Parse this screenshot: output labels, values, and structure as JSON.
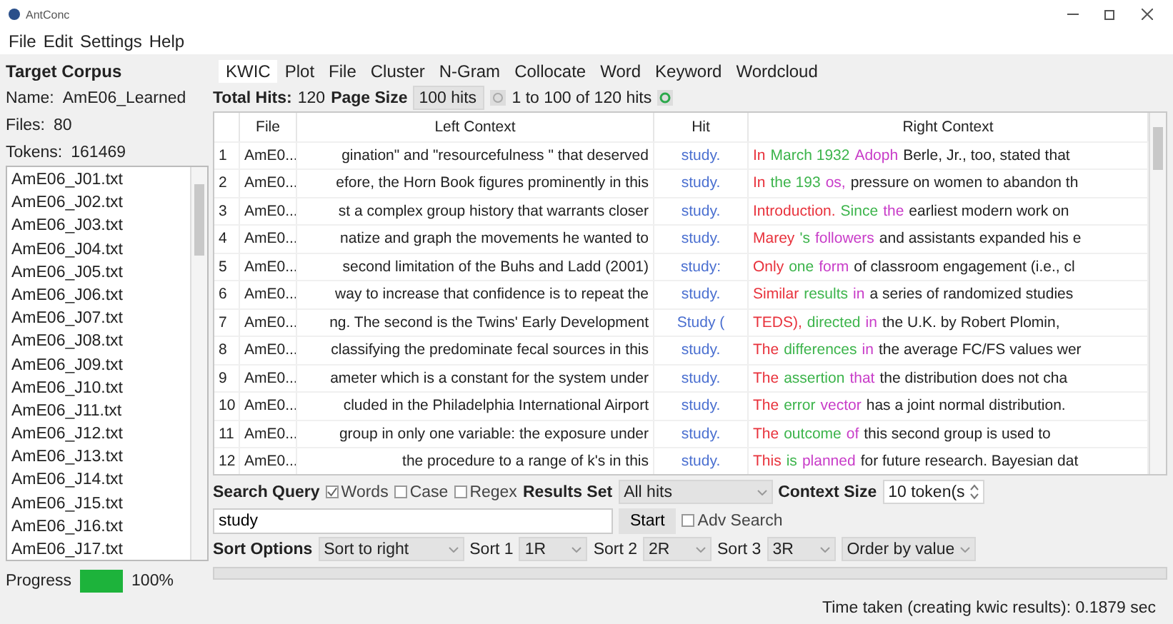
{
  "window": {
    "title": "AntConc"
  },
  "menu": [
    "File",
    "Edit",
    "Settings",
    "Help"
  ],
  "target_corpus": {
    "heading": "Target Corpus",
    "name_label": "Name:",
    "name": "AmE06_Learned",
    "files_label": "Files:",
    "files": "80",
    "tokens_label": "Tokens:",
    "tokens": "161469",
    "files_list": [
      "AmE06_J01.txt",
      "AmE06_J02.txt",
      "AmE06_J03.txt",
      "AmE06_J04.txt",
      "AmE06_J05.txt",
      "AmE06_J06.txt",
      "AmE06_J07.txt",
      "AmE06_J08.txt",
      "AmE06_J09.txt",
      "AmE06_J10.txt",
      "AmE06_J11.txt",
      "AmE06_J12.txt",
      "AmE06_J13.txt",
      "AmE06_J14.txt",
      "AmE06_J15.txt",
      "AmE06_J16.txt",
      "AmE06_J17.txt"
    ],
    "progress": {
      "label": "Progress",
      "level": 1,
      "reading": "100%"
    }
  },
  "tabs": [
    {
      "label": "KWIC",
      "selected": true
    },
    {
      "label": "Plot",
      "selected": false
    },
    {
      "label": "File",
      "selected": false
    },
    {
      "label": "Cluster",
      "selected": false
    },
    {
      "label": "N-Gram",
      "selected": false
    },
    {
      "label": "Collocate",
      "selected": false
    },
    {
      "label": "Word",
      "selected": false
    },
    {
      "label": "Keyword",
      "selected": false
    },
    {
      "label": "Wordcloud",
      "selected": false
    }
  ],
  "results_bar": {
    "total_hits_label": "Total Hits:",
    "total_hits": "120",
    "page_size_label": "Page Size",
    "page_size": "100 hits",
    "range": "1 to 100 of 120 hits"
  },
  "table": {
    "columns": [
      "File",
      "Left Context",
      "Hit",
      "Right Context"
    ],
    "rows": [
      {
        "number": "1",
        "file": "AmE0...",
        "left": "gination\" and \"resourcefulness \" that deserved",
        "hit": "study.",
        "right": [
          {
            "text": "In",
            "color": "#e8323c"
          },
          {
            "text": "March 1932",
            "color": "#3cb44b"
          },
          {
            "text": "Adoph",
            "color": "#c83cc8"
          }
        ],
        "rest": "Berle, Jr., too, stated that"
      },
      {
        "number": "2",
        "file": "AmE0...",
        "left": "efore, the Horn Book figures prominently in this",
        "hit": "study.",
        "right": [
          {
            "text": "In",
            "color": "#e8323c"
          },
          {
            "text": "the 193",
            "color": "#3cb44b"
          },
          {
            "text": "os,",
            "color": "#c83cc8"
          }
        ],
        "rest": "pressure on women to abandon th"
      },
      {
        "number": "3",
        "file": "AmE0...",
        "left": "st a complex group history that warrants closer",
        "hit": "study.",
        "right": [
          {
            "text": "Introduction.",
            "color": "#e8323c"
          },
          {
            "text": "Since",
            "color": "#3cb44b"
          },
          {
            "text": "the",
            "color": "#c83cc8"
          }
        ],
        "rest": "earliest modern work on"
      },
      {
        "number": "4",
        "file": "AmE0...",
        "left": "natize and graph the movements he wanted to",
        "hit": "study.",
        "right": [
          {
            "text": "Marey",
            "color": "#e8323c"
          },
          {
            "text": "'s",
            "color": "#3cb44b"
          },
          {
            "text": "followers",
            "color": "#c83cc8"
          }
        ],
        "rest": "and assistants expanded his e"
      },
      {
        "number": "5",
        "file": "AmE0...",
        "left": "second limitation of the Buhs and Ladd (2001)",
        "hit": "study:",
        "right": [
          {
            "text": "Only",
            "color": "#e8323c"
          },
          {
            "text": "one",
            "color": "#3cb44b"
          },
          {
            "text": "form",
            "color": "#c83cc8"
          }
        ],
        "rest": "of classroom engagement (i.e., cl"
      },
      {
        "number": "6",
        "file": "AmE0...",
        "left": "way to increase that confidence is to repeat the",
        "hit": "study.",
        "right": [
          {
            "text": "Similar",
            "color": "#e8323c"
          },
          {
            "text": "results",
            "color": "#3cb44b"
          },
          {
            "text": "in",
            "color": "#c83cc8"
          }
        ],
        "rest": "a series of randomized studies"
      },
      {
        "number": "7",
        "file": "AmE0...",
        "left": "ng. The second is the Twins' Early Development",
        "hit": "Study (",
        "right": [
          {
            "text": "TEDS),",
            "color": "#e8323c"
          },
          {
            "text": "directed",
            "color": "#3cb44b"
          },
          {
            "text": "in",
            "color": "#c83cc8"
          }
        ],
        "rest": "the U.K. by Robert Plomin,"
      },
      {
        "number": "8",
        "file": "AmE0...",
        "left": "classifying the predominate fecal sources in this",
        "hit": "study.",
        "right": [
          {
            "text": "The",
            "color": "#e8323c"
          },
          {
            "text": "differences",
            "color": "#3cb44b"
          },
          {
            "text": "in",
            "color": "#c83cc8"
          }
        ],
        "rest": "the average FC/FS values wer"
      },
      {
        "number": "9",
        "file": "AmE0...",
        "left": "ameter which is a constant for the system under",
        "hit": "study.",
        "right": [
          {
            "text": "The",
            "color": "#e8323c"
          },
          {
            "text": "assertion",
            "color": "#3cb44b"
          },
          {
            "text": "that",
            "color": "#c83cc8"
          }
        ],
        "rest": "the distribution does not cha"
      },
      {
        "number": "10",
        "file": "AmE0...",
        "left": "cluded in the Philadelphia International Airport",
        "hit": "study.",
        "right": [
          {
            "text": "The",
            "color": "#e8323c"
          },
          {
            "text": "error",
            "color": "#3cb44b"
          },
          {
            "text": "vector",
            "color": "#c83cc8"
          }
        ],
        "rest": "has a joint normal distribution."
      },
      {
        "number": "11",
        "file": "AmE0...",
        "left": "group in only one variable: the exposure under",
        "hit": "study.",
        "right": [
          {
            "text": "The",
            "color": "#e8323c"
          },
          {
            "text": "outcome",
            "color": "#3cb44b"
          },
          {
            "text": "of",
            "color": "#c83cc8"
          }
        ],
        "rest": "this second group is used to"
      },
      {
        "number": "12",
        "file": "AmE0...",
        "left": "the procedure to a range of k's in this",
        "hit": "study.",
        "right": [
          {
            "text": "This",
            "color": "#e8323c"
          },
          {
            "text": "is",
            "color": "#3cb44b"
          },
          {
            "text": "planned",
            "color": "#c83cc8"
          }
        ],
        "rest": "for future research. Bayesian dat"
      }
    ]
  },
  "search": {
    "label": "Search Query",
    "options": [
      {
        "label": "Words",
        "checked": true
      },
      {
        "label": "Case",
        "checked": false
      },
      {
        "label": "Regex",
        "checked": false
      }
    ],
    "results_set_label": "Results Set",
    "results_set": "All hits",
    "context_size_label": "Context Size",
    "context_size": "10 token(s",
    "query": "study",
    "start": "Start",
    "adv_search": {
      "label": "Adv Search",
      "checked": false
    }
  },
  "sort": {
    "label": "Sort Options",
    "mode": "Sort to right",
    "levels": [
      {
        "label": "Sort 1",
        "value": "1R"
      },
      {
        "label": "Sort 2",
        "value": "2R"
      },
      {
        "label": "Sort 3",
        "value": "3R"
      }
    ],
    "order": "Order by value"
  },
  "status": "Time taken (creating kwic results):  0.1879 sec"
}
